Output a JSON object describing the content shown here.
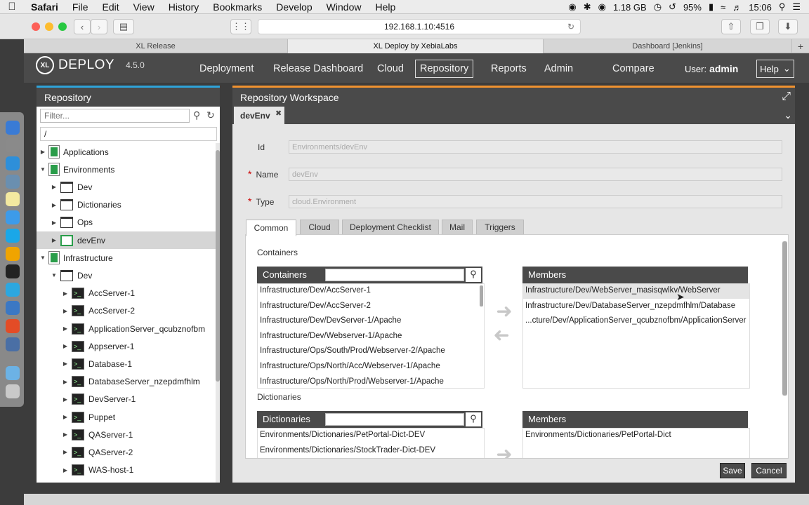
{
  "menubar": {
    "app": "Safari",
    "items": [
      "File",
      "Edit",
      "View",
      "History",
      "Bookmarks",
      "Develop",
      "Window",
      "Help"
    ],
    "memory": "1.18 GB",
    "battery": "95%",
    "time": "15:06"
  },
  "browser": {
    "url": "192.168.1.10:4516",
    "tabs": [
      "XL Release",
      "XL Deploy by XebiaLabs",
      "Dashboard [Jenkins]"
    ],
    "active_tab": 1
  },
  "app": {
    "brand": "DEPLOY",
    "brand_prefix": "XL",
    "version": "4.5.0",
    "nav": [
      "Deployment",
      "Release Dashboard",
      "Cloud",
      "Repository",
      "Reports",
      "Admin",
      "Compare"
    ],
    "active_nav": "Repository",
    "user_label": "User:",
    "user_name": "admin",
    "help_label": "Help"
  },
  "repository": {
    "title": "Repository",
    "filter_placeholder": "Filter...",
    "root": "/",
    "tree": [
      {
        "label": "Applications",
        "depth": 0,
        "icon": "doc",
        "arrow": "right"
      },
      {
        "label": "Environments",
        "depth": 0,
        "icon": "doc",
        "arrow": "down"
      },
      {
        "label": "Dev",
        "depth": 1,
        "icon": "folder",
        "arrow": "right"
      },
      {
        "label": "Dictionaries",
        "depth": 1,
        "icon": "folder",
        "arrow": "right"
      },
      {
        "label": "Ops",
        "depth": 1,
        "icon": "folder",
        "arrow": "right"
      },
      {
        "label": "devEnv",
        "depth": 1,
        "icon": "env",
        "arrow": "right",
        "selected": true
      },
      {
        "label": "Infrastructure",
        "depth": 0,
        "icon": "doc",
        "arrow": "down"
      },
      {
        "label": "Dev",
        "depth": 1,
        "icon": "folder",
        "arrow": "down"
      },
      {
        "label": "AccServer-1",
        "depth": 2,
        "icon": "server",
        "arrow": "right"
      },
      {
        "label": "AccServer-2",
        "depth": 2,
        "icon": "server",
        "arrow": "right"
      },
      {
        "label": "ApplicationServer_qcubznofbm",
        "depth": 2,
        "icon": "server",
        "arrow": "right"
      },
      {
        "label": "Appserver-1",
        "depth": 2,
        "icon": "server",
        "arrow": "right"
      },
      {
        "label": "Database-1",
        "depth": 2,
        "icon": "server",
        "arrow": "right"
      },
      {
        "label": "DatabaseServer_nzepdmfhlm",
        "depth": 2,
        "icon": "server",
        "arrow": "right"
      },
      {
        "label": "DevServer-1",
        "depth": 2,
        "icon": "server",
        "arrow": "right"
      },
      {
        "label": "Puppet",
        "depth": 2,
        "icon": "server",
        "arrow": "right"
      },
      {
        "label": "QAServer-1",
        "depth": 2,
        "icon": "server",
        "arrow": "right"
      },
      {
        "label": "QAServer-2",
        "depth": 2,
        "icon": "server",
        "arrow": "right"
      },
      {
        "label": "WAS-host-1",
        "depth": 2,
        "icon": "server",
        "arrow": "right"
      }
    ]
  },
  "workspace": {
    "title": "Repository Workspace",
    "tab": "devEnv",
    "fields": {
      "id_label": "Id",
      "id_value": "Environments/devEnv",
      "name_label": "Name",
      "name_value": "devEnv",
      "type_label": "Type",
      "type_value": "cloud.Environment"
    },
    "form_tabs": [
      "Common",
      "Cloud",
      "Deployment Checklist",
      "Mail",
      "Triggers"
    ],
    "active_form_tab": "Common",
    "containers": {
      "section": "Containers",
      "header": "Containers",
      "items": [
        "Infrastructure/Dev/AccServer-1",
        "Infrastructure/Dev/AccServer-2",
        "Infrastructure/Dev/DevServer-1/Apache",
        "Infrastructure/Dev/Webserver-1/Apache",
        "Infrastructure/Ops/South/Prod/Webserver-2/Apache",
        "Infrastructure/Ops/North/Acc/Webserver-1/Apache",
        "Infrastructure/Ops/North/Prod/Webserver-1/Apache"
      ],
      "members_header": "Members",
      "members": [
        "Infrastructure/Dev/WebServer_masisqwlkv/WebServer",
        "Infrastructure/Dev/DatabaseServer_nzepdmfhlm/Database",
        "...cture/Dev/ApplicationServer_qcubznofbm/ApplicationServer"
      ]
    },
    "dictionaries": {
      "section": "Dictionaries",
      "header": "Dictionaries",
      "items": [
        "Environments/Dictionaries/PetPortal-Dict-DEV",
        "Environments/Dictionaries/StockTrader-Dict-DEV"
      ],
      "members_header": "Members",
      "members": [
        "Environments/Dictionaries/PetPortal-Dict"
      ]
    },
    "save_label": "Save",
    "cancel_label": "Cancel"
  },
  "colors": {
    "header": "#4a4a4a",
    "repo_accent": "#2ea3d9",
    "ws_accent": "#f0922f",
    "ci_green": "#2a9d4a"
  }
}
